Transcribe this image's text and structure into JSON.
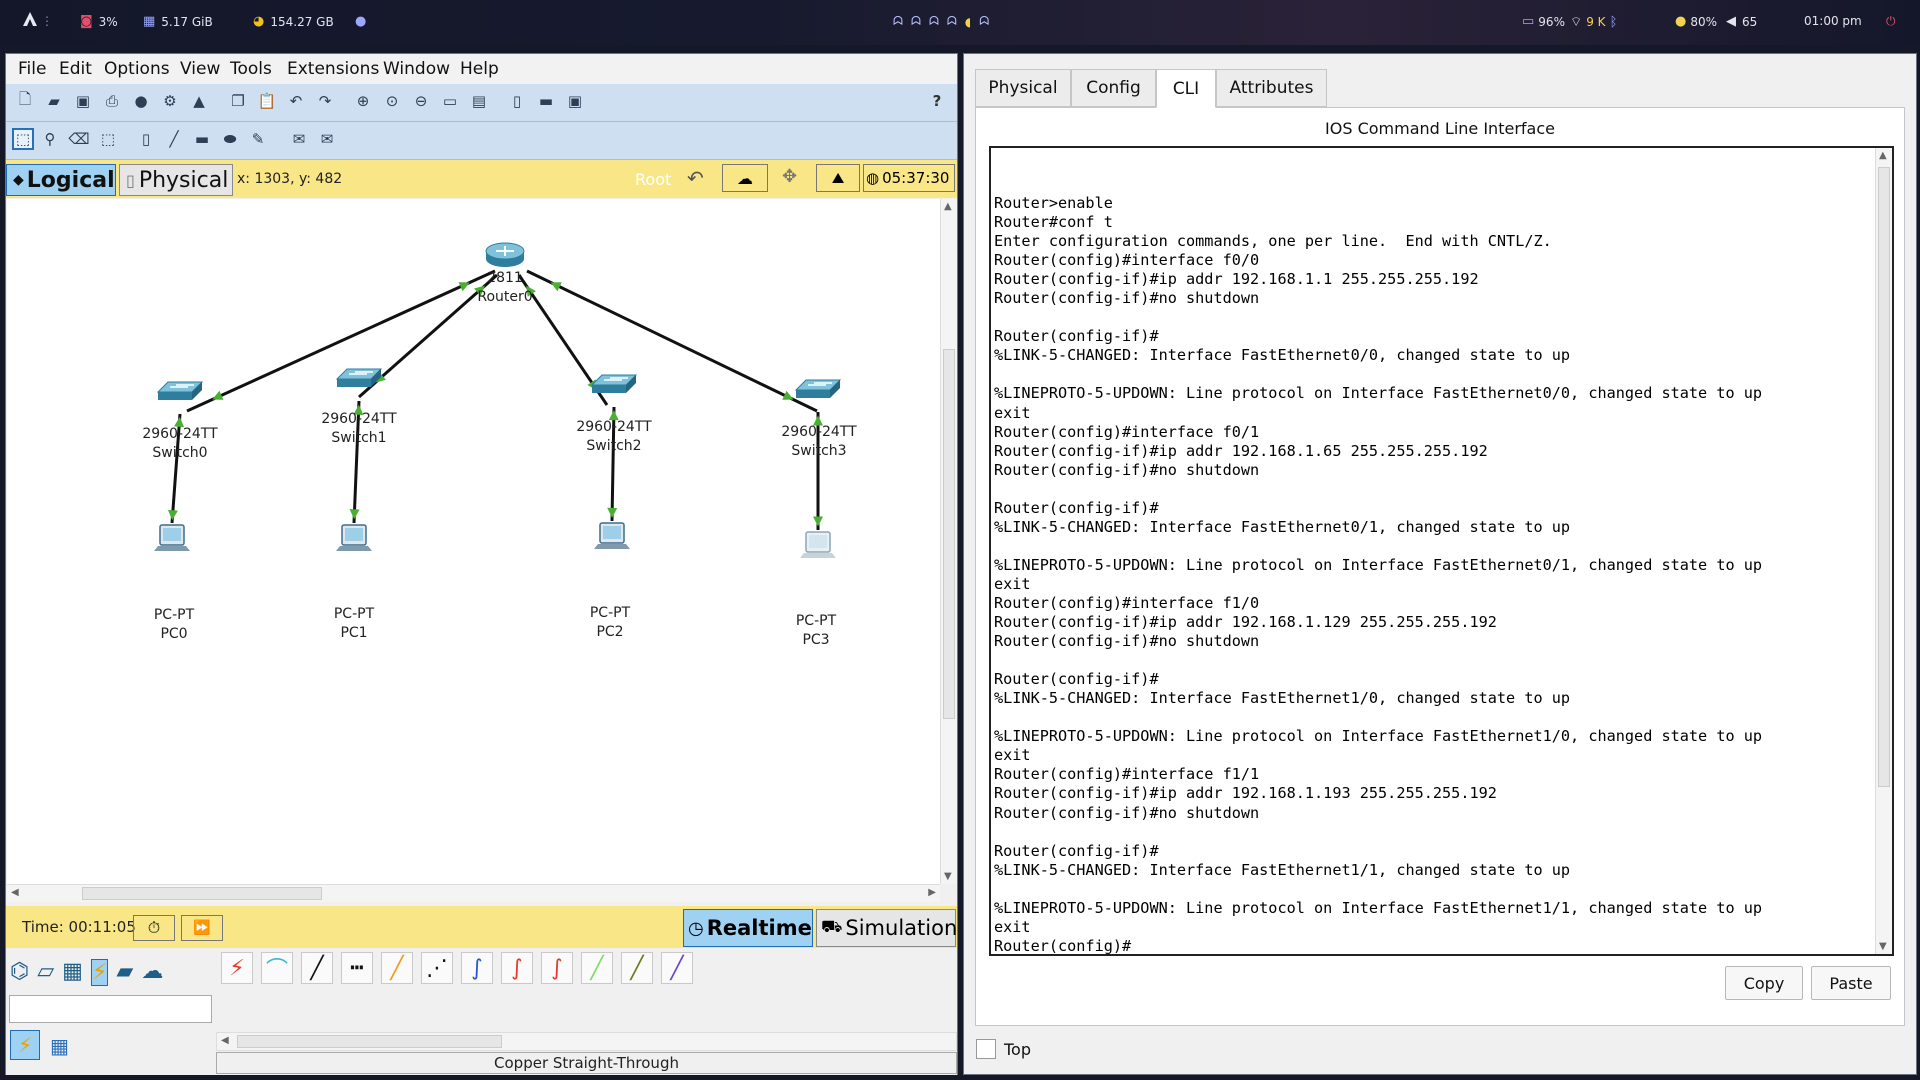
{
  "taskbar": {
    "cpu": "3%",
    "ram": "5.17 GiB",
    "disk": "154.27 GB",
    "battery": "96%",
    "network": "9 K",
    "brightness": "80%",
    "volume": "65",
    "clock": "01:00 pm",
    "colors": {
      "cpu": "#e0506a",
      "disk": "#f2c21b",
      "accent": "#9aa8ff"
    }
  },
  "menu": [
    "File",
    "Edit",
    "Options",
    "View",
    "Tools",
    "Extensions",
    "Window",
    "Help"
  ],
  "toolbar": {
    "help_label": "?"
  },
  "workspace": {
    "logical_label": "Logical",
    "physical_label": "Physical",
    "coords": "x: 1303, y: 482",
    "root_label": "Root",
    "clock": "05:37:30"
  },
  "topology": {
    "router": {
      "model": "2811",
      "name": "Router0"
    },
    "switches": [
      {
        "model": "2960-24TT",
        "name": "Switch0"
      },
      {
        "model": "2960-24TT",
        "name": "Switch1"
      },
      {
        "model": "2960-24TT",
        "name": "Switch2"
      },
      {
        "model": "2960-24TT",
        "name": "Switch3"
      }
    ],
    "pcs": [
      {
        "model": "PC-PT",
        "name": "PC0"
      },
      {
        "model": "PC-PT",
        "name": "PC1"
      },
      {
        "model": "PC-PT",
        "name": "PC2"
      },
      {
        "model": "PC-PT",
        "name": "PC3"
      }
    ],
    "link_color": "#4cae33"
  },
  "timebar": {
    "time": "Time: 00:11:05",
    "realtime_label": "Realtime",
    "simulation_label": "Simulation"
  },
  "device_panel": {
    "status": "Copper Straight-Through"
  },
  "cli_window": {
    "tabs": [
      "Physical",
      "Config",
      "CLI",
      "Attributes"
    ],
    "active_tab": "CLI",
    "title": "IOS Command Line Interface",
    "output": "Router>enable\nRouter#conf t\nEnter configuration commands, one per line.  End with CNTL/Z.\nRouter(config)#interface f0/0\nRouter(config-if)#ip addr 192.168.1.1 255.255.255.192\nRouter(config-if)#no shutdown\n\nRouter(config-if)#\n%LINK-5-CHANGED: Interface FastEthernet0/0, changed state to up\n\n%LINEPROTO-5-UPDOWN: Line protocol on Interface FastEthernet0/0, changed state to up\nexit\nRouter(config)#interface f0/1\nRouter(config-if)#ip addr 192.168.1.65 255.255.255.192\nRouter(config-if)#no shutdown\n\nRouter(config-if)#\n%LINK-5-CHANGED: Interface FastEthernet0/1, changed state to up\n\n%LINEPROTO-5-UPDOWN: Line protocol on Interface FastEthernet0/1, changed state to up\nexit\nRouter(config)#interface f1/0\nRouter(config-if)#ip addr 192.168.1.129 255.255.255.192\nRouter(config-if)#no shutdown\n\nRouter(config-if)#\n%LINK-5-CHANGED: Interface FastEthernet1/0, changed state to up\n\n%LINEPROTO-5-UPDOWN: Line protocol on Interface FastEthernet1/0, changed state to up\nexit\nRouter(config)#interface f1/1\nRouter(config-if)#ip addr 192.168.1.193 255.255.255.192\nRouter(config-if)#no shutdown\n\nRouter(config-if)#\n%LINK-5-CHANGED: Interface FastEthernet1/1, changed state to up\n\n%LINEPROTO-5-UPDOWN: Line protocol on Interface FastEthernet1/1, changed state to up\nexit\nRouter(config)#",
    "copy_label": "Copy",
    "paste_label": "Paste",
    "top_label": "Top"
  }
}
